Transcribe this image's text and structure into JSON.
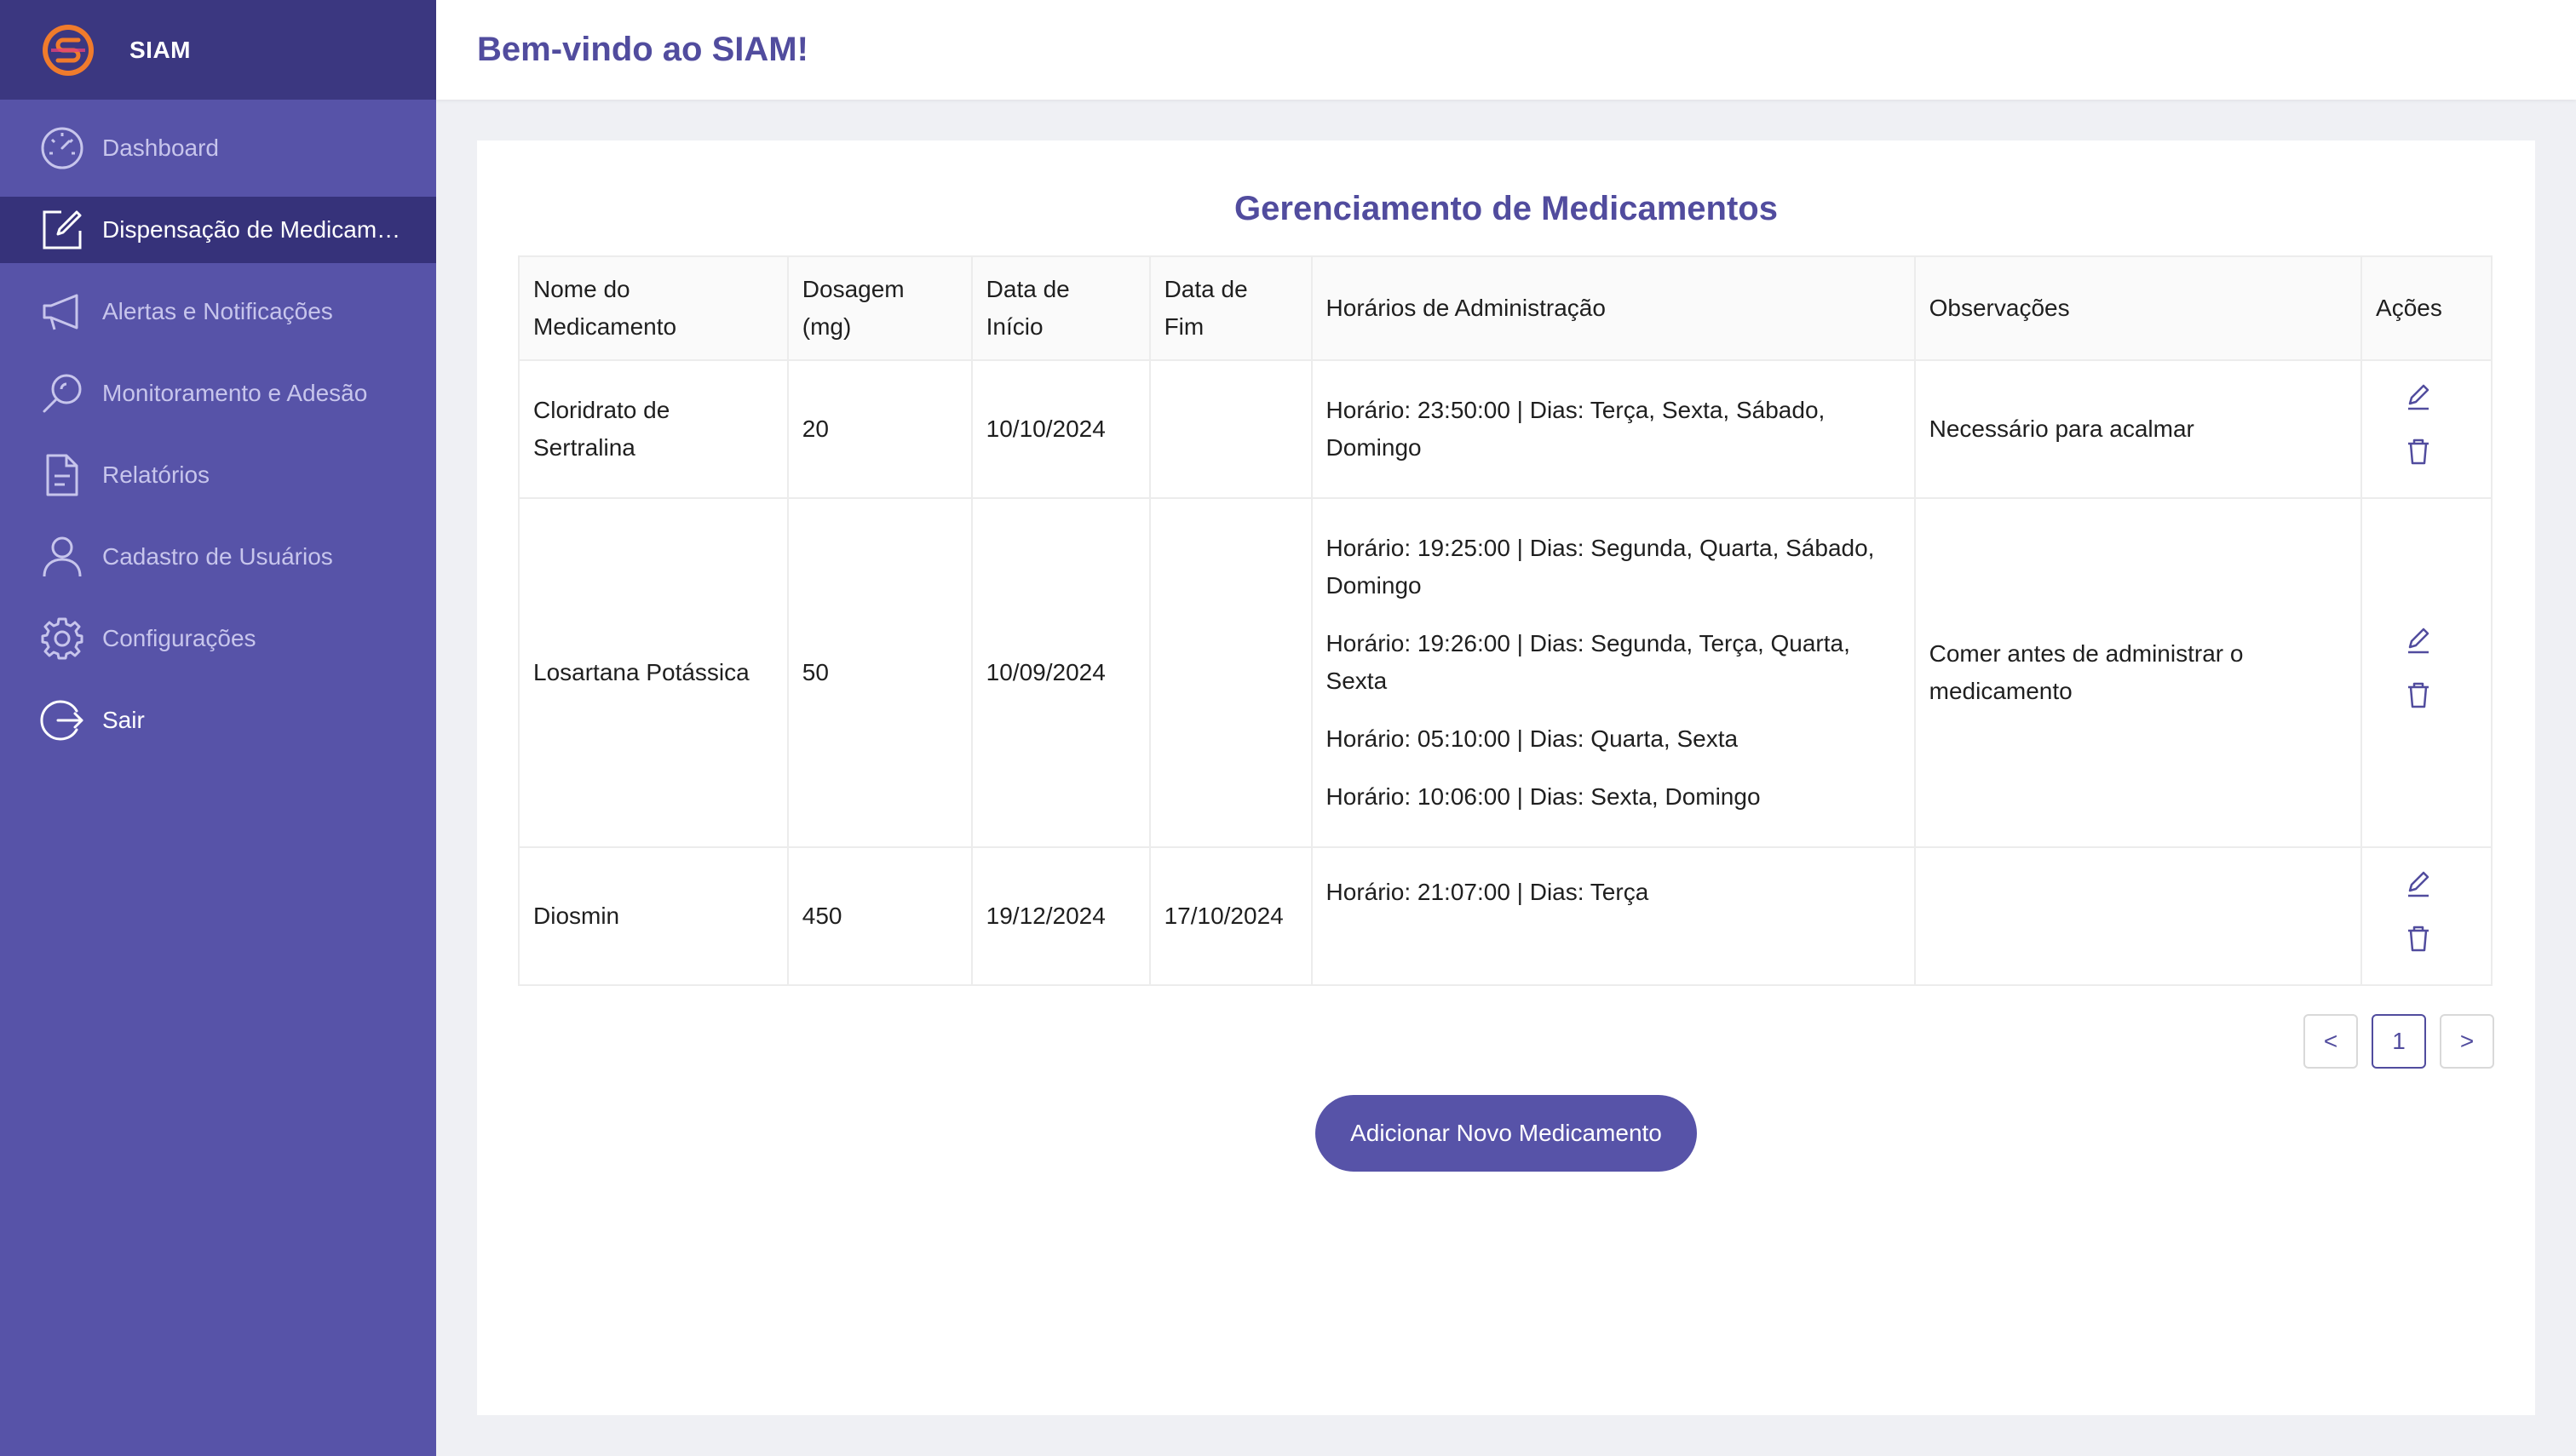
{
  "app": {
    "name": "SIAM",
    "welcome": "Bem-vindo ao SIAM!"
  },
  "sidebar": {
    "items": [
      {
        "label": "Dashboard",
        "icon": "dashboard-icon"
      },
      {
        "label": "Dispensação de Medicamentos",
        "icon": "edit-icon"
      },
      {
        "label": "Alertas e Notificações",
        "icon": "megaphone-icon"
      },
      {
        "label": "Monitoramento e Adesão",
        "icon": "search-icon"
      },
      {
        "label": "Relatórios",
        "icon": "file-icon"
      },
      {
        "label": "Cadastro de Usuários",
        "icon": "user-icon"
      },
      {
        "label": "Configurações",
        "icon": "gear-icon"
      },
      {
        "label": "Sair",
        "icon": "logout-icon"
      }
    ]
  },
  "main": {
    "title": "Gerenciamento de Medicamentos",
    "columns": {
      "name_l1": "Nome do",
      "name_l2": "Medicamento",
      "dose_l1": "Dosagem",
      "dose_l2": "(mg)",
      "start_l1": "Data de",
      "start_l2": "Início",
      "end_l1": "Data de",
      "end_l2": "Fim",
      "schedules": "Horários de Administração",
      "notes": "Observações",
      "actions": "Ações"
    },
    "rows": [
      {
        "name": "Cloridrato de Sertralina",
        "dosage": "20",
        "start": "10/10/2024",
        "end": "",
        "schedules": [
          "Horário: 23:50:00 | Dias: Terça, Sexta, Sábado, Domingo"
        ],
        "notes": "Necessário para acalmar"
      },
      {
        "name": "Losartana Potássica",
        "dosage": "50",
        "start": "10/09/2024",
        "end": "",
        "schedules": [
          "Horário: 19:25:00 | Dias: Segunda, Quarta, Sábado, Domingo",
          "Horário: 19:26:00 | Dias: Segunda, Terça, Quarta, Sexta",
          "Horário: 05:10:00 | Dias: Quarta, Sexta",
          "Horário: 10:06:00 | Dias: Sexta, Domingo"
        ],
        "notes": "Comer antes de administrar o medicamento"
      },
      {
        "name": "Diosmin",
        "dosage": "450",
        "start": "19/12/2024",
        "end": "17/10/2024",
        "schedules": [
          "Horário: 21:07:00 | Dias: Terça"
        ],
        "notes": ""
      }
    ],
    "pagination": {
      "prev": "<",
      "current": "1",
      "next": ">"
    },
    "add_button": "Adicionar Novo Medicamento"
  },
  "colors": {
    "sidebar_bg": "#5753a8",
    "sidebar_header_bg": "#3b3780",
    "active_item_bg": "#36327a",
    "accent": "#514c9e"
  }
}
